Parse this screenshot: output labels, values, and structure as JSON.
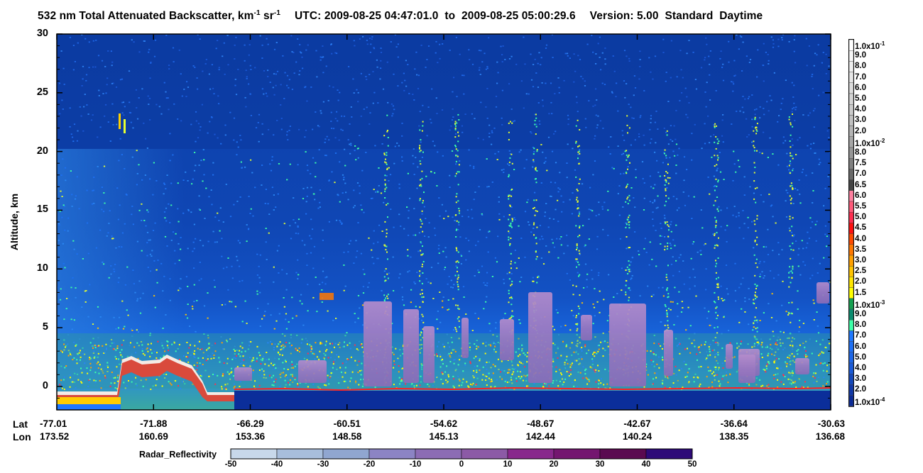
{
  "title": {
    "main": "532 nm Total Attenuated Backscatter, km",
    "unit_exp1": "-1",
    "unit_mid": " sr",
    "unit_exp2": "-1",
    "utc_label": "UTC:",
    "utc_start": "2009-08-25 04:47:01.0",
    "to": "to",
    "utc_end": "2009-08-25 05:00:29.6",
    "version": "Version: 5.00",
    "product": "Standard",
    "mode": "Daytime"
  },
  "chart_data": {
    "type": "heatmap",
    "title": "532 nm Total Attenuated Backscatter, km-1 sr-1",
    "ylabel": "Altitude, km",
    "ylim": [
      -2,
      30
    ],
    "yticks": [
      "30",
      "25",
      "20",
      "15",
      "10",
      "5",
      "0"
    ],
    "lat_label": "Lat",
    "lon_label": "Lon",
    "lat": [
      "-77.01",
      "-71.88",
      "-66.29",
      "-60.51",
      "-54.62",
      "-48.67",
      "-42.67",
      "-36.64",
      "-30.63"
    ],
    "lon": [
      "173.52",
      "160.69",
      "153.36",
      "148.58",
      "145.13",
      "142.44",
      "140.24",
      "138.35",
      "136.68"
    ],
    "backscatter_colorbar": [
      {
        "label": "1.0x10",
        "exp": "-1",
        "color": "#ffffff"
      },
      {
        "label": "9.0",
        "color": "#f7f7f7"
      },
      {
        "label": "8.0",
        "color": "#efefef"
      },
      {
        "label": "7.0",
        "color": "#e6e6e6"
      },
      {
        "label": "6.0",
        "color": "#dddddd"
      },
      {
        "label": "5.0",
        "color": "#d4d4d4"
      },
      {
        "label": "4.0",
        "color": "#cbcbcb"
      },
      {
        "label": "3.0",
        "color": "#c1c1c1"
      },
      {
        "label": "2.0",
        "color": "#b4b4b4"
      },
      {
        "label": "1.0x10",
        "exp": "-2",
        "color": "#a6a6a6"
      },
      {
        "label": "8.0",
        "color": "#969696"
      },
      {
        "label": "7.5",
        "color": "#808080"
      },
      {
        "label": "7.0",
        "color": "#6a6a6a"
      },
      {
        "label": "6.5",
        "color": "#454545"
      },
      {
        "label": "6.0",
        "color": "#ff80a0"
      },
      {
        "label": "5.5",
        "color": "#ff5a7a"
      },
      {
        "label": "5.0",
        "color": "#ff2e50"
      },
      {
        "label": "4.5",
        "color": "#ff1010"
      },
      {
        "label": "4.0",
        "color": "#ff4a00"
      },
      {
        "label": "3.5",
        "color": "#ff7800"
      },
      {
        "label": "3.0",
        "color": "#ffa000"
      },
      {
        "label": "2.5",
        "color": "#ffc400"
      },
      {
        "label": "2.0",
        "color": "#ffe600"
      },
      {
        "label": "1.5",
        "color": "#ffff00"
      },
      {
        "label": "1.0x10",
        "exp": "-3",
        "color": "#14a050"
      },
      {
        "label": "9.0",
        "color": "#0a8c70"
      },
      {
        "label": "8.0",
        "color": "#3cffa8"
      },
      {
        "label": "7.0",
        "color": "#1e78ff"
      },
      {
        "label": "6.0",
        "color": "#1e70f5"
      },
      {
        "label": "5.0",
        "color": "#1c66e8"
      },
      {
        "label": "4.0",
        "color": "#1a5ad8"
      },
      {
        "label": "3.0",
        "color": "#1448bb"
      },
      {
        "label": "2.0",
        "color": "#1038a8"
      },
      {
        "label": "1.0x10",
        "exp": "-4",
        "color": "#0a2a96"
      }
    ],
    "radar_colorbar": {
      "label": "Radar_Reflectivity",
      "ticks": [
        "-50",
        "-40",
        "-30",
        "-20",
        "-10",
        "0",
        "10",
        "20",
        "30",
        "40",
        "50"
      ],
      "colors": [
        "#c8d8ea",
        "#a8bedc",
        "#90a6d0",
        "#8c84c4",
        "#8c6cb4",
        "#8c5aa6",
        "#88288c",
        "#741670",
        "#5a0a50",
        "#2e0a78"
      ]
    }
  }
}
